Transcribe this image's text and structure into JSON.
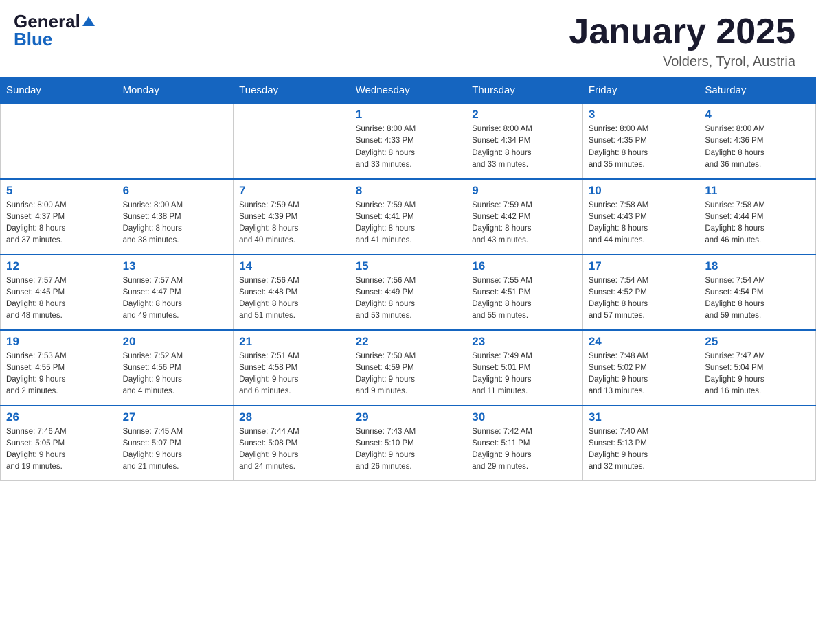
{
  "header": {
    "logo_general": "General",
    "logo_blue": "Blue",
    "month_title": "January 2025",
    "location": "Volders, Tyrol, Austria"
  },
  "days_of_week": [
    "Sunday",
    "Monday",
    "Tuesday",
    "Wednesday",
    "Thursday",
    "Friday",
    "Saturday"
  ],
  "weeks": [
    [
      {
        "day": "",
        "info": ""
      },
      {
        "day": "",
        "info": ""
      },
      {
        "day": "",
        "info": ""
      },
      {
        "day": "1",
        "info": "Sunrise: 8:00 AM\nSunset: 4:33 PM\nDaylight: 8 hours\nand 33 minutes."
      },
      {
        "day": "2",
        "info": "Sunrise: 8:00 AM\nSunset: 4:34 PM\nDaylight: 8 hours\nand 33 minutes."
      },
      {
        "day": "3",
        "info": "Sunrise: 8:00 AM\nSunset: 4:35 PM\nDaylight: 8 hours\nand 35 minutes."
      },
      {
        "day": "4",
        "info": "Sunrise: 8:00 AM\nSunset: 4:36 PM\nDaylight: 8 hours\nand 36 minutes."
      }
    ],
    [
      {
        "day": "5",
        "info": "Sunrise: 8:00 AM\nSunset: 4:37 PM\nDaylight: 8 hours\nand 37 minutes."
      },
      {
        "day": "6",
        "info": "Sunrise: 8:00 AM\nSunset: 4:38 PM\nDaylight: 8 hours\nand 38 minutes."
      },
      {
        "day": "7",
        "info": "Sunrise: 7:59 AM\nSunset: 4:39 PM\nDaylight: 8 hours\nand 40 minutes."
      },
      {
        "day": "8",
        "info": "Sunrise: 7:59 AM\nSunset: 4:41 PM\nDaylight: 8 hours\nand 41 minutes."
      },
      {
        "day": "9",
        "info": "Sunrise: 7:59 AM\nSunset: 4:42 PM\nDaylight: 8 hours\nand 43 minutes."
      },
      {
        "day": "10",
        "info": "Sunrise: 7:58 AM\nSunset: 4:43 PM\nDaylight: 8 hours\nand 44 minutes."
      },
      {
        "day": "11",
        "info": "Sunrise: 7:58 AM\nSunset: 4:44 PM\nDaylight: 8 hours\nand 46 minutes."
      }
    ],
    [
      {
        "day": "12",
        "info": "Sunrise: 7:57 AM\nSunset: 4:45 PM\nDaylight: 8 hours\nand 48 minutes."
      },
      {
        "day": "13",
        "info": "Sunrise: 7:57 AM\nSunset: 4:47 PM\nDaylight: 8 hours\nand 49 minutes."
      },
      {
        "day": "14",
        "info": "Sunrise: 7:56 AM\nSunset: 4:48 PM\nDaylight: 8 hours\nand 51 minutes."
      },
      {
        "day": "15",
        "info": "Sunrise: 7:56 AM\nSunset: 4:49 PM\nDaylight: 8 hours\nand 53 minutes."
      },
      {
        "day": "16",
        "info": "Sunrise: 7:55 AM\nSunset: 4:51 PM\nDaylight: 8 hours\nand 55 minutes."
      },
      {
        "day": "17",
        "info": "Sunrise: 7:54 AM\nSunset: 4:52 PM\nDaylight: 8 hours\nand 57 minutes."
      },
      {
        "day": "18",
        "info": "Sunrise: 7:54 AM\nSunset: 4:54 PM\nDaylight: 8 hours\nand 59 minutes."
      }
    ],
    [
      {
        "day": "19",
        "info": "Sunrise: 7:53 AM\nSunset: 4:55 PM\nDaylight: 9 hours\nand 2 minutes."
      },
      {
        "day": "20",
        "info": "Sunrise: 7:52 AM\nSunset: 4:56 PM\nDaylight: 9 hours\nand 4 minutes."
      },
      {
        "day": "21",
        "info": "Sunrise: 7:51 AM\nSunset: 4:58 PM\nDaylight: 9 hours\nand 6 minutes."
      },
      {
        "day": "22",
        "info": "Sunrise: 7:50 AM\nSunset: 4:59 PM\nDaylight: 9 hours\nand 9 minutes."
      },
      {
        "day": "23",
        "info": "Sunrise: 7:49 AM\nSunset: 5:01 PM\nDaylight: 9 hours\nand 11 minutes."
      },
      {
        "day": "24",
        "info": "Sunrise: 7:48 AM\nSunset: 5:02 PM\nDaylight: 9 hours\nand 13 minutes."
      },
      {
        "day": "25",
        "info": "Sunrise: 7:47 AM\nSunset: 5:04 PM\nDaylight: 9 hours\nand 16 minutes."
      }
    ],
    [
      {
        "day": "26",
        "info": "Sunrise: 7:46 AM\nSunset: 5:05 PM\nDaylight: 9 hours\nand 19 minutes."
      },
      {
        "day": "27",
        "info": "Sunrise: 7:45 AM\nSunset: 5:07 PM\nDaylight: 9 hours\nand 21 minutes."
      },
      {
        "day": "28",
        "info": "Sunrise: 7:44 AM\nSunset: 5:08 PM\nDaylight: 9 hours\nand 24 minutes."
      },
      {
        "day": "29",
        "info": "Sunrise: 7:43 AM\nSunset: 5:10 PM\nDaylight: 9 hours\nand 26 minutes."
      },
      {
        "day": "30",
        "info": "Sunrise: 7:42 AM\nSunset: 5:11 PM\nDaylight: 9 hours\nand 29 minutes."
      },
      {
        "day": "31",
        "info": "Sunrise: 7:40 AM\nSunset: 5:13 PM\nDaylight: 9 hours\nand 32 minutes."
      },
      {
        "day": "",
        "info": ""
      }
    ]
  ]
}
